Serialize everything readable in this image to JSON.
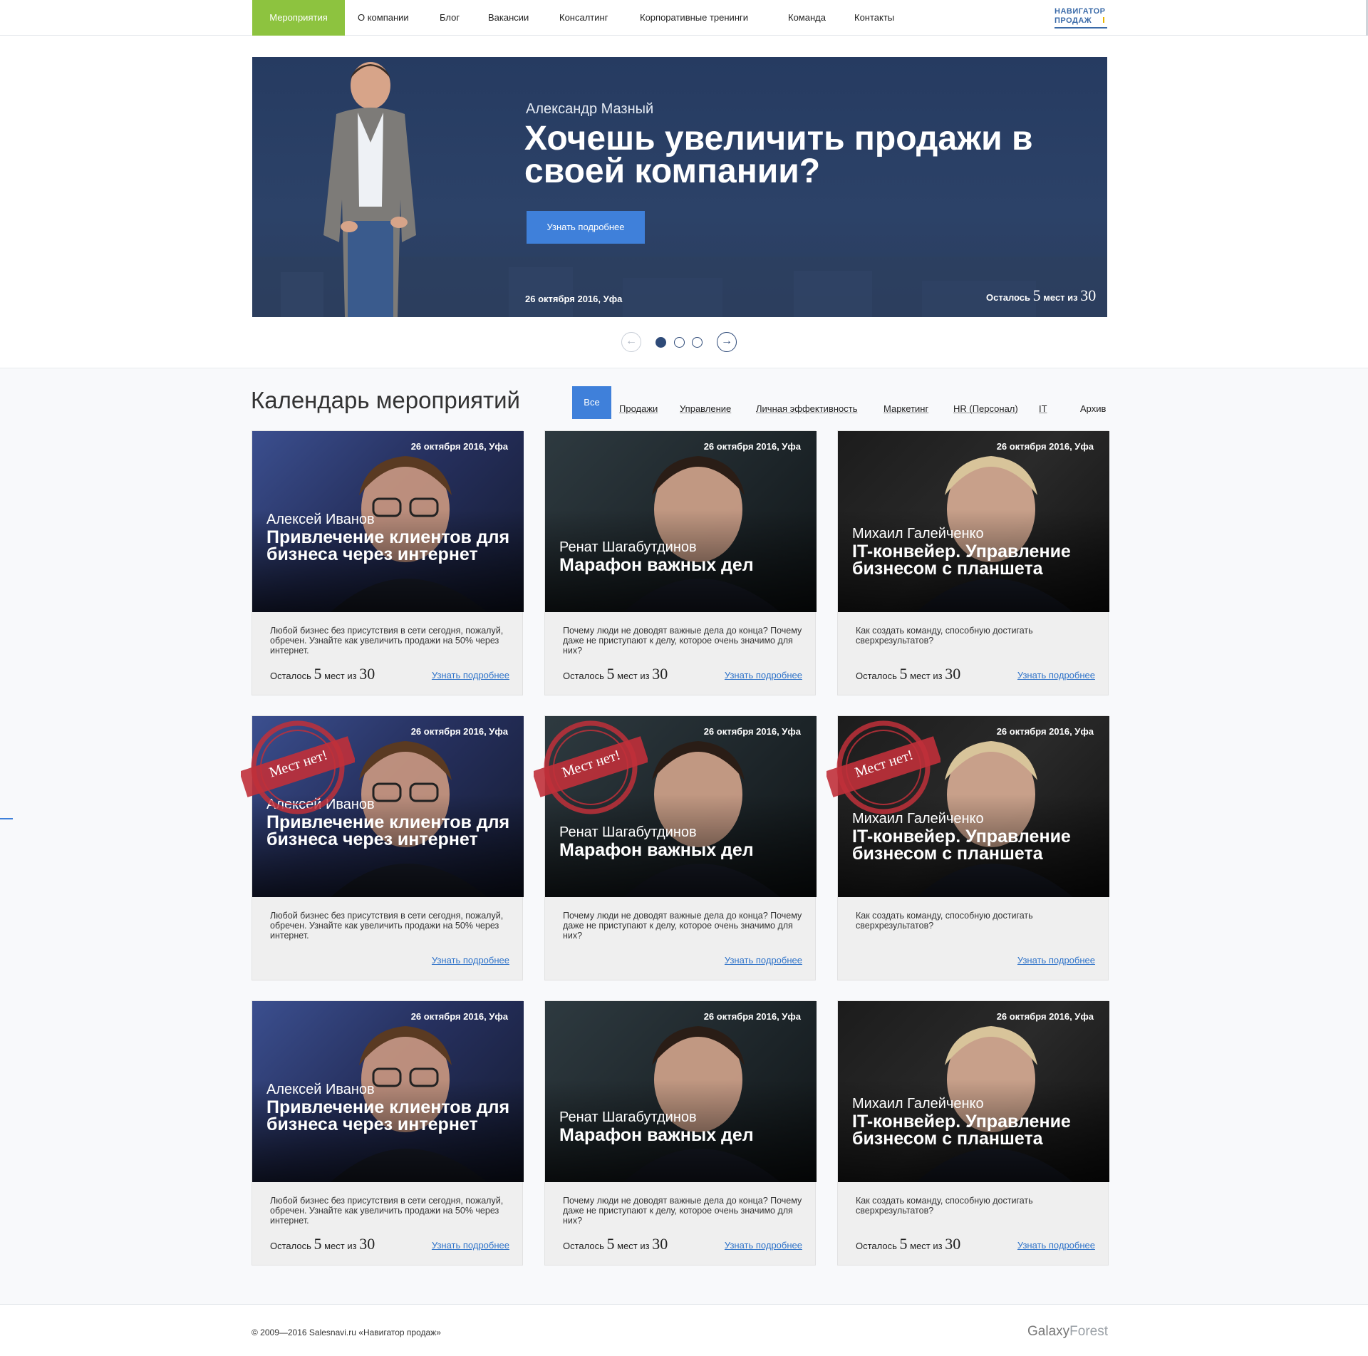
{
  "nav": {
    "items": [
      "Мероприятия",
      "О компании",
      "Блог",
      "Вакансии",
      "Консалтинг",
      "Корпоративные тренинги",
      "Команда",
      "Контакты"
    ],
    "logo": {
      "line1": "НАВИГАТОР",
      "line2": "ПРОДАЖ"
    }
  },
  "hero": {
    "speaker": "Александр Мазный",
    "title": "Хочешь увеличить продажи в своей компании?",
    "button": "Узнать подробнее",
    "date": "26 октября 2016,  Уфа",
    "seats": {
      "prefix": "Осталось",
      "left": "5",
      "middle": "мест из",
      "total": "30"
    }
  },
  "slider": {
    "prev_icon": "arrow-left-icon",
    "next_icon": "arrow-right-icon",
    "active_index": 0,
    "count": 3
  },
  "calendar": {
    "title": "Календарь мероприятий",
    "filters": [
      "Все",
      "Продажи",
      "Управление",
      "Личная эффективность",
      "Маркетинг",
      "HR (Персонал)",
      "IT",
      "Архив"
    ],
    "active_filter": "Все"
  },
  "cards": [
    {
      "date": "26 октября 2016,  Уфа",
      "speaker": "Алексей Иванов",
      "title": "Привлечение клиентов для бизнеса через интернет",
      "desc": "Любой бизнес без присутствия в сети сегодня, пожалуй, обречен. Узнайте как увеличить продажи на 50% через интернет.",
      "seats_prefix": "Осталось",
      "seats_left": "5",
      "seats_middle": "мест из",
      "seats_total": "30",
      "link": "Узнать подробнее",
      "sold_out": false
    },
    {
      "date": "26 октября 2016,  Уфа",
      "speaker": "Ренат Шагабутдинов",
      "title": "Марафон важных дел",
      "desc": "Почему люди не доводят важные дела до конца? Почему даже не приступают к делу, которое очень значимо для них?",
      "seats_prefix": "Осталось",
      "seats_left": "5",
      "seats_middle": "мест из",
      "seats_total": "30",
      "link": "Узнать подробнее",
      "sold_out": false
    },
    {
      "date": "26 октября 2016,  Уфа",
      "speaker": "Михаил Галейченко",
      "title": "IT-конвейер. Управление бизнесом с планшета",
      "desc": "Как создать команду, способную достигать сверхрезультатов?",
      "seats_prefix": "Осталось",
      "seats_left": "5",
      "seats_middle": "мест из",
      "seats_total": "30",
      "link": "Узнать подробнее",
      "sold_out": false
    },
    {
      "date": "26 октября 2016,  Уфа",
      "speaker": "Алексей Иванов",
      "title": "Привлечение клиентов для бизнеса через интернет",
      "desc": "Любой бизнес без присутствия в сети сегодня, пожалуй, обречен. Узнайте как увеличить продажи на 50% через интернет.",
      "link": "Узнать подробнее",
      "sold_out": true,
      "stamp": "Мест нет!"
    },
    {
      "date": "26 октября 2016,  Уфа",
      "speaker": "Ренат Шагабутдинов",
      "title": "Марафон важных дел",
      "desc": "Почему люди не доводят важные дела до конца? Почему даже не приступают к делу, которое очень значимо для них?",
      "link": "Узнать подробнее",
      "sold_out": true,
      "stamp": "Мест нет!"
    },
    {
      "date": "26 октября 2016,  Уфа",
      "speaker": "Михаил Галейченко",
      "title": "IT-конвейер. Управление бизнесом с планшета",
      "desc": "Как создать команду, способную достигать сверхрезультатов?",
      "link": "Узнать подробнее",
      "sold_out": true,
      "stamp": "Мест нет!"
    },
    {
      "date": "26 октября 2016,  Уфа",
      "speaker": "Алексей Иванов",
      "title": "Привлечение клиентов для бизнеса через интернет",
      "desc": "Любой бизнес без присутствия в сети сегодня, пожалуй, обречен. Узнайте как увеличить продажи на 50% через интернет.",
      "seats_prefix": "Осталось",
      "seats_left": "5",
      "seats_middle": "мест из",
      "seats_total": "30",
      "link": "Узнать подробнее",
      "sold_out": false
    },
    {
      "date": "26 октября 2016,  Уфа",
      "speaker": "Ренат Шагабутдинов",
      "title": "Марафон важных дел",
      "desc": "Почему люди не доводят важные дела до конца? Почему даже не приступают к делу, которое очень значимо для них?",
      "seats_prefix": "Осталось",
      "seats_left": "5",
      "seats_middle": "мест из",
      "seats_total": "30",
      "link": "Узнать подробнее",
      "sold_out": false
    },
    {
      "date": "26 октября 2016,  Уфа",
      "speaker": "Михаил Галейченко",
      "title": "IT-конвейер. Управление бизнесом с планшета",
      "desc": "Как создать команду, способную достигать сверхрезультатов?",
      "seats_prefix": "Осталось",
      "seats_left": "5",
      "seats_middle": "мест из",
      "seats_total": "30",
      "link": "Узнать подробнее",
      "sold_out": false
    }
  ],
  "footer": {
    "copyright": "© 2009—2016 Salesnavi.ru «Навигатор продаж»",
    "studio": {
      "part1": "Galaxy",
      "part2": "Forest"
    }
  },
  "colors": {
    "nav_active": "#8dc33f",
    "accent_blue": "#3f80da",
    "hero_bg": "#283d63",
    "stamp_red": "#c0303a"
  }
}
